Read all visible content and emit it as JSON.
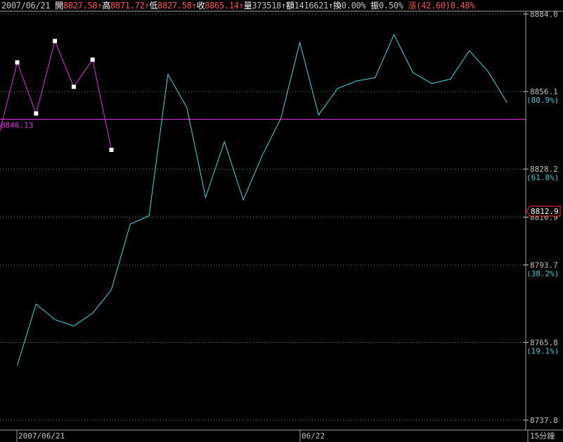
{
  "header": {
    "date": "2007/06/21",
    "open_label": "開",
    "open": "8827.58",
    "high_label": "高",
    "high": "8871.72",
    "low_label": "低",
    "low": "8827.58",
    "close_label": "收",
    "close": "8865.14",
    "vol_label": "量",
    "vol": "373518",
    "amt_label": "額",
    "amt": "1416621",
    "turn_label": "換",
    "turn": "0.00%",
    "amp_label": "振",
    "amp": "0.50%",
    "chg_label": "漲",
    "chg": "(42.60)0.48%",
    "arrow": "↑"
  },
  "colors": {
    "background": "#000000",
    "cyan_line": "#40d8e0",
    "magenta_line": "#e030e0",
    "grid": "#808080",
    "marker": "#ffffff",
    "price_tag": "#ff3030"
  },
  "chart_data": {
    "type": "line",
    "ylim": [
      8737.8,
      8884.0
    ],
    "y_ticks": [
      "8884.0",
      "8856.1",
      "8828.2",
      "8810.9",
      "8793.7",
      "8765.8",
      "8737.8"
    ],
    "y_tick_values": [
      8884.0,
      8856.1,
      8828.2,
      8810.9,
      8793.7,
      8765.8,
      8737.8
    ],
    "retracement_labels": [
      {
        "value": 8856.1,
        "text": "(80.9%)"
      },
      {
        "value": 8828.2,
        "text": "(61.8%)"
      },
      {
        "value": 8793.7,
        "text": "(38.2%)"
      },
      {
        "value": 8765.8,
        "text": "(19.1%)"
      }
    ],
    "hline": {
      "value": 8846.13,
      "text": "8846.13"
    },
    "current_price": "8812.9",
    "x_labels": [
      "2007/06/21",
      "06/22"
    ],
    "period": "15分鐘",
    "series": [
      {
        "style": "cyan",
        "x": [
          1,
          2,
          3,
          4,
          5,
          6,
          7,
          8,
          9,
          10,
          11,
          12,
          13,
          14,
          15,
          16,
          17,
          18,
          19,
          20,
          21,
          22,
          23,
          24,
          25,
          26,
          27
        ],
        "values": [
          8757.5,
          8779.6,
          8774.0,
          8771.7,
          8776.3,
          8784.8,
          8808.4,
          8811.4,
          8862.3,
          8850.4,
          8818.0,
          8838.1,
          8817.1,
          8833.0,
          8846.5,
          8873.8,
          8847.7,
          8857.2,
          8859.9,
          8861.1,
          8876.6,
          8863.0,
          8859.0,
          8860.6,
          8870.8,
          8863.3,
          8852.1
        ]
      },
      {
        "style": "magenta",
        "x": [
          -0.5,
          1,
          2,
          3,
          4,
          5,
          6
        ],
        "values": [
          8826.4,
          8866.6,
          8848.2,
          8874.3,
          8857.8,
          8867.6,
          8835.1
        ],
        "markers": true
      }
    ]
  }
}
